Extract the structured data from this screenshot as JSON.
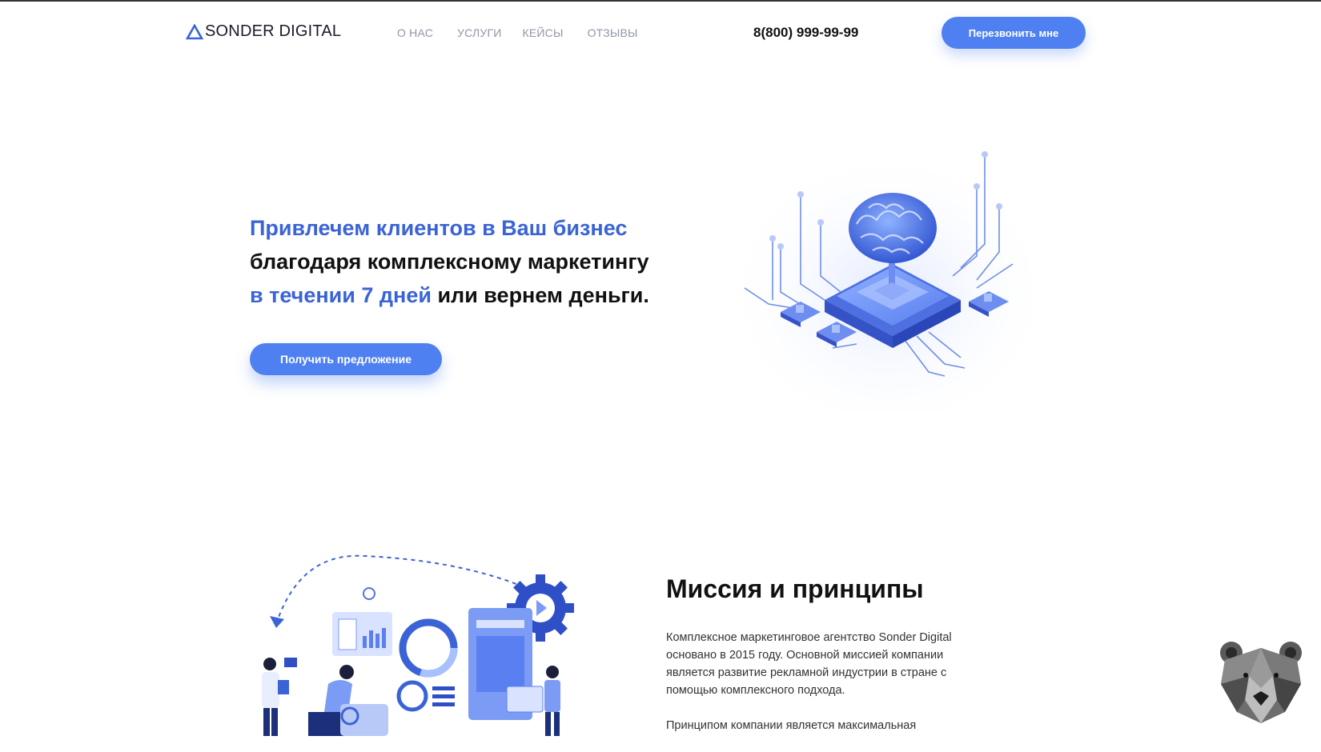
{
  "brand": {
    "name": "SONDER DIGITAL"
  },
  "nav": [
    {
      "label": "О НАС"
    },
    {
      "label": "УСЛУГИ"
    },
    {
      "label": "КЕЙСЫ"
    },
    {
      "label": "ОТЗЫВЫ"
    }
  ],
  "header": {
    "phone": "8(800) 999-99-99",
    "callback_label": "Перезвонить мне"
  },
  "hero": {
    "line1_blue": "Привлечем клиентов в Ваш бизнес",
    "line2": "благодаря комплексному маркетингу",
    "line3_blue": "в течении 7 дней",
    "line3_rest": " или вернем деньги.",
    "cta_label": "Получить предложение",
    "illustration_icon": "brain-chip-icon"
  },
  "mission": {
    "title": "Миссия и принципы",
    "paragraph1": "Комплексное маркетинговое агентство Sonder Digital основано в 2015 году. Основной миссией компании является развитие рекламной индустрии в стране с помощью комплексного подхода.",
    "paragraph2": "Принципом компании является максимальная",
    "illustration_icon": "team-dashboard-icon"
  },
  "widget": {
    "icon": "bear-icon"
  },
  "colors": {
    "accent": "#4f80f1",
    "heading_blue": "#3a63d6"
  }
}
